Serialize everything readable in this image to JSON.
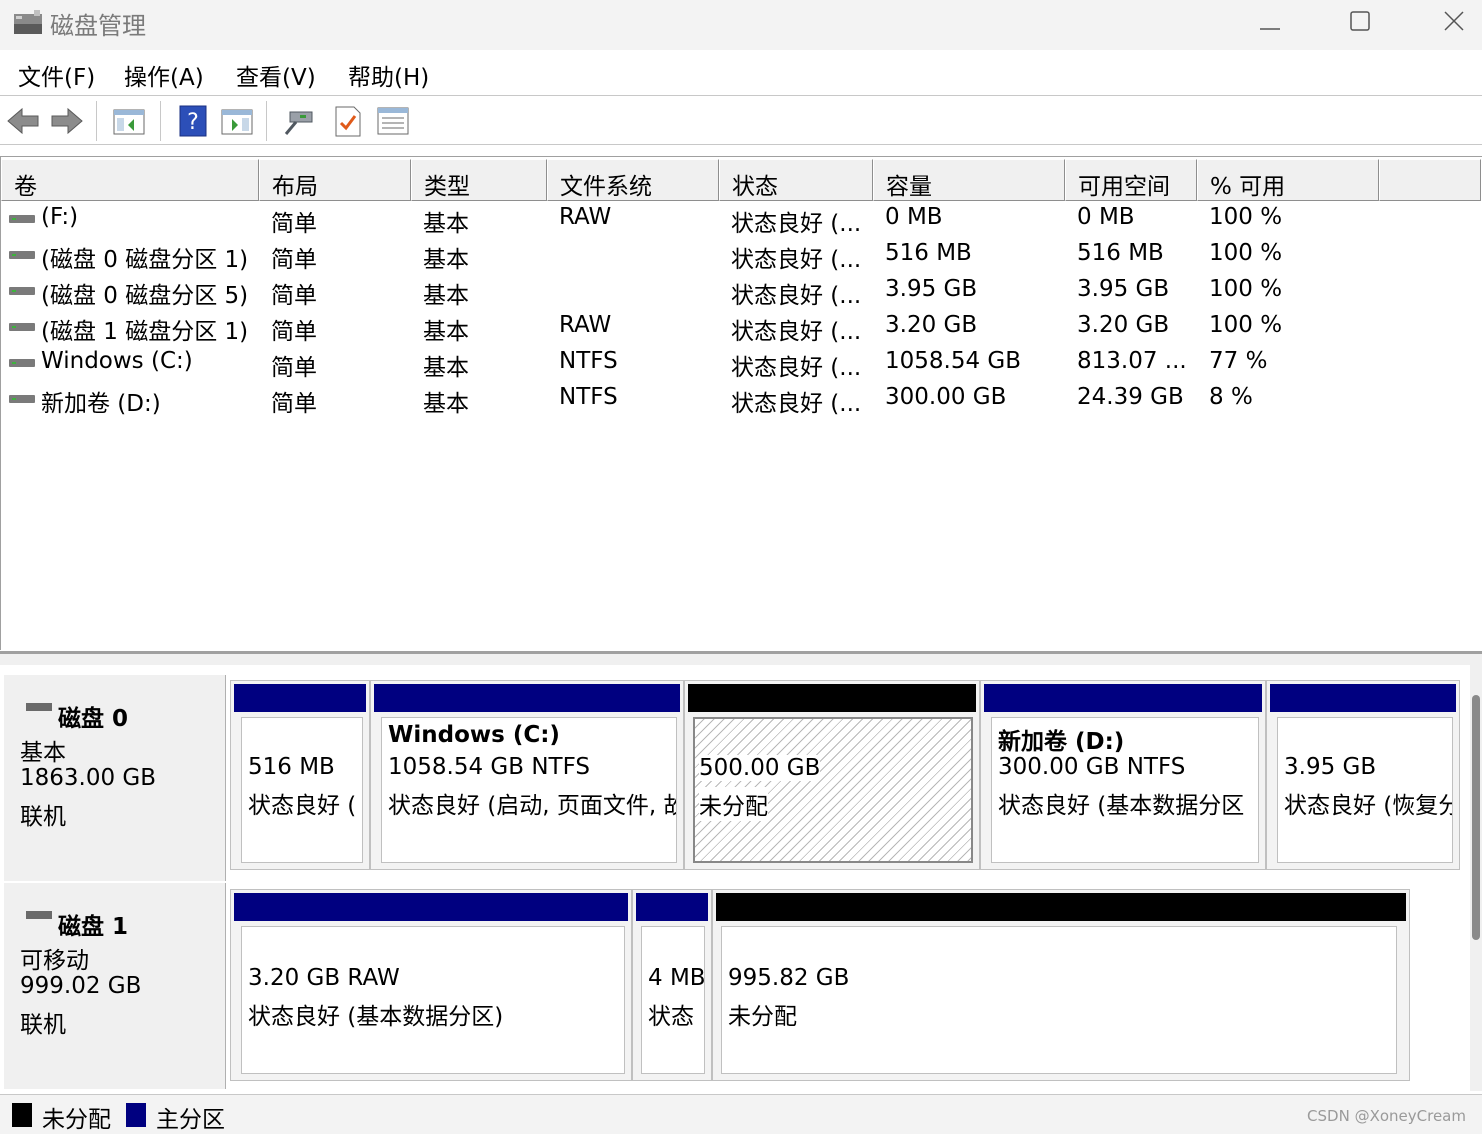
{
  "window": {
    "title": "磁盘管理"
  },
  "menu": [
    "文件(F)",
    "操作(A)",
    "查看(V)",
    "帮助(H)"
  ],
  "toolbar": [
    "back-icon",
    "forward-icon",
    "console-tree-icon",
    "help-icon",
    "action-pane-icon",
    "connect-icon",
    "checklist-icon",
    "properties-icon"
  ],
  "table": {
    "columns": [
      "卷",
      "布局",
      "类型",
      "文件系统",
      "状态",
      "容量",
      "可用空间",
      "% 可用"
    ],
    "rows": [
      {
        "volume": " (F:)",
        "layout": "简单",
        "type": "基本",
        "fs": "RAW",
        "status": "状态良好 (...",
        "capacity": "0 MB",
        "free": "0 MB",
        "pct": "100 %"
      },
      {
        "volume": "(磁盘 0 磁盘分区 1)",
        "layout": "简单",
        "type": "基本",
        "fs": "",
        "status": "状态良好 (...",
        "capacity": "516 MB",
        "free": "516 MB",
        "pct": "100 %"
      },
      {
        "volume": "(磁盘 0 磁盘分区 5)",
        "layout": "简单",
        "type": "基本",
        "fs": "",
        "status": "状态良好 (...",
        "capacity": "3.95 GB",
        "free": "3.95 GB",
        "pct": "100 %"
      },
      {
        "volume": "(磁盘 1 磁盘分区 1)",
        "layout": "简单",
        "type": "基本",
        "fs": "RAW",
        "status": "状态良好 (...",
        "capacity": "3.20 GB",
        "free": "3.20 GB",
        "pct": "100 %"
      },
      {
        "volume": "Windows (C:)",
        "layout": "简单",
        "type": "基本",
        "fs": "NTFS",
        "status": "状态良好 (...",
        "capacity": "1058.54 GB",
        "free": "813.07 ...",
        "pct": "77 %"
      },
      {
        "volume": "新加卷 (D:)",
        "layout": "简单",
        "type": "基本",
        "fs": "NTFS",
        "status": "状态良好 (...",
        "capacity": "300.00 GB",
        "free": "24.39 GB",
        "pct": "8 %"
      }
    ]
  },
  "disks": [
    {
      "name": "磁盘 0",
      "kind": "基本",
      "size": "1863.00 GB",
      "state": "联机",
      "partitions": [
        {
          "title": "",
          "line1": "516 MB",
          "line2": "状态良好 (",
          "style": "primary"
        },
        {
          "title": "Windows  (C:)",
          "line1": "1058.54 GB NTFS",
          "line2": "状态良好 (启动, 页面文件, 故",
          "style": "primary"
        },
        {
          "title": "",
          "line1": "500.00 GB",
          "line2": "未分配",
          "style": "unallocated"
        },
        {
          "title": "新加卷  (D:)",
          "line1": "300.00 GB NTFS",
          "line2": "状态良好 (基本数据分区",
          "style": "primary"
        },
        {
          "title": "",
          "line1": "3.95 GB",
          "line2": "状态良好 (恢复分",
          "style": "primary"
        }
      ]
    },
    {
      "name": "磁盘 1",
      "kind": "可移动",
      "size": "999.02 GB",
      "state": "联机",
      "partitions": [
        {
          "title": "",
          "line1": "3.20 GB RAW",
          "line2": "状态良好 (基本数据分区)",
          "style": "primary"
        },
        {
          "title": "",
          "line1": "4 MB",
          "line2": "状态",
          "style": "primary"
        },
        {
          "title": "",
          "line1": "995.82 GB",
          "line2": "未分配",
          "style": "unallocated"
        }
      ]
    }
  ],
  "legend": [
    {
      "label": "未分配",
      "color": "#000000"
    },
    {
      "label": "主分区",
      "color": "#000080"
    }
  ],
  "watermark": "CSDN @XoneyCream",
  "colors": {
    "primary_bar": "#000080",
    "unallocated_bar": "#000000"
  }
}
